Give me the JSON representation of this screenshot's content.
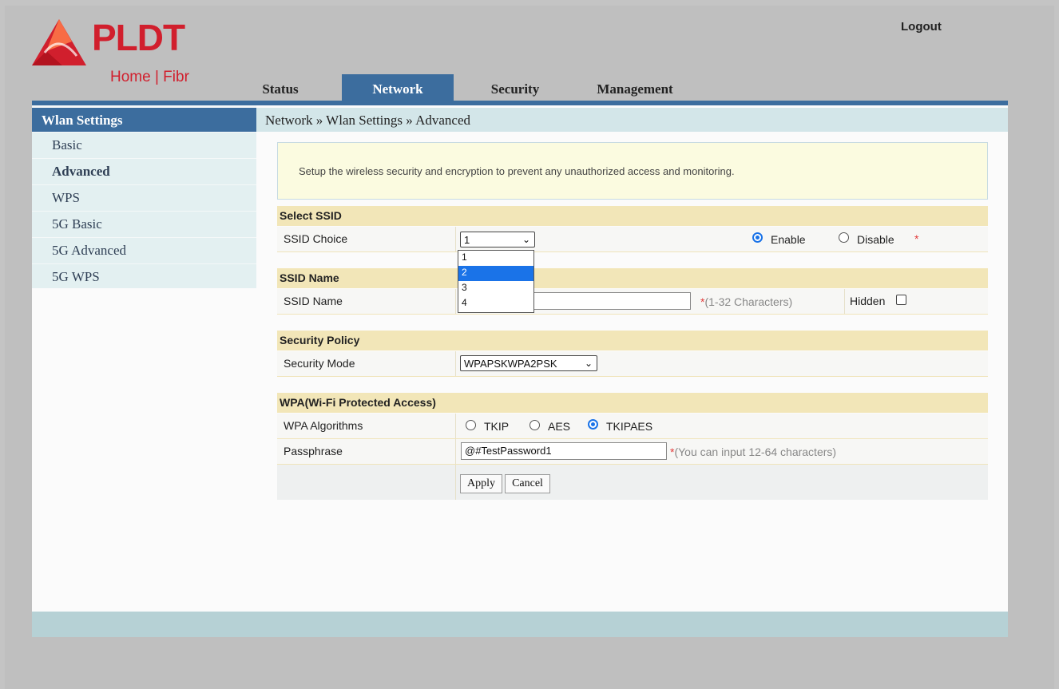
{
  "brand": {
    "name": "PLDT",
    "sub": "Home | Fibr"
  },
  "header": {
    "logout": "Logout"
  },
  "tabs": [
    {
      "label": "Status"
    },
    {
      "label": "Network",
      "active": true
    },
    {
      "label": "Security"
    },
    {
      "label": "Management"
    }
  ],
  "sidebar": {
    "title": "Wlan Settings",
    "items": [
      {
        "label": "Basic"
      },
      {
        "label": "Advanced",
        "selected": true
      },
      {
        "label": "WPS"
      },
      {
        "label": "5G Basic"
      },
      {
        "label": "5G Advanced"
      },
      {
        "label": "5G WPS"
      }
    ]
  },
  "breadcrumb": "Network » Wlan Settings » Advanced",
  "notice": "Setup the wireless security and encryption to prevent any unauthorized access and monitoring.",
  "select_ssid": {
    "title": "Select SSID",
    "label": "SSID Choice",
    "value": "1",
    "options": [
      "1",
      "2",
      "3",
      "4"
    ],
    "highlighted": "2",
    "enable_label": "Enable",
    "disable_label": "Disable",
    "enabled": true,
    "required_mark": "*"
  },
  "ssid_name": {
    "title": "SSID Name",
    "label": "SSID Name",
    "value": "",
    "hint": "*(1-32 Characters)",
    "hidden_label": "Hidden",
    "hidden_checked": false
  },
  "security_policy": {
    "title": "Security Policy",
    "label": "Security Mode",
    "value": "WPAPSKWPA2PSK"
  },
  "wpa": {
    "title": "WPA(Wi-Fi Protected Access)",
    "algorithms_label": "WPA Algorithms",
    "algorithms": [
      "TKIP",
      "AES",
      "TKIPAES"
    ],
    "selected_algorithm": "TKIPAES",
    "passphrase_label": "Passphrase",
    "passphrase_value": "@#TestPassword1",
    "passphrase_hint": "*(You can input 12-64 characters)"
  },
  "actions": {
    "apply": "Apply",
    "cancel": "Cancel"
  },
  "colors": {
    "brand_red": "#d11f2d",
    "nav_blue": "#3c6d9e",
    "section_tan": "#f2e6b8",
    "radio_blue": "#1a73e8"
  }
}
